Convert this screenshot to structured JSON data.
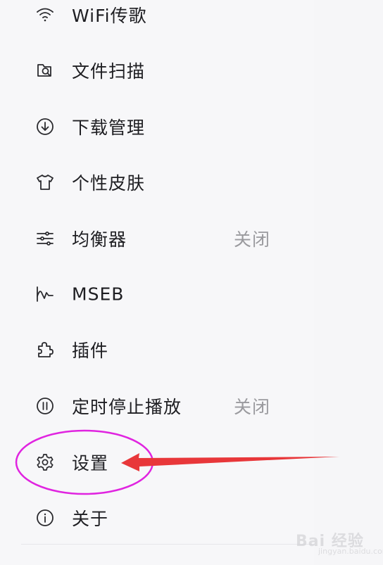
{
  "menu": {
    "items": [
      {
        "label": "WiFi传歌",
        "icon": "wifi-icon"
      },
      {
        "label": "文件扫描",
        "icon": "file-scan-icon"
      },
      {
        "label": "下载管理",
        "icon": "download-icon"
      },
      {
        "label": "个性皮肤",
        "icon": "tshirt-icon"
      },
      {
        "label": "均衡器",
        "value": "关闭",
        "icon": "equalizer-icon"
      },
      {
        "label": "MSEB",
        "icon": "waveform-icon"
      },
      {
        "label": "插件",
        "icon": "puzzle-icon"
      },
      {
        "label": "定时停止播放",
        "value": "关闭",
        "icon": "timer-icon"
      },
      {
        "label": "设置",
        "icon": "gear-icon"
      },
      {
        "label": "关于",
        "icon": "info-icon"
      }
    ]
  },
  "annotation": {
    "circle_color": "#e024e0",
    "arrow_color": "#e8373a",
    "highlighted_item": "设置"
  },
  "watermark": {
    "text": "Bai 经验",
    "sub": "jingyan.baidu.com"
  }
}
